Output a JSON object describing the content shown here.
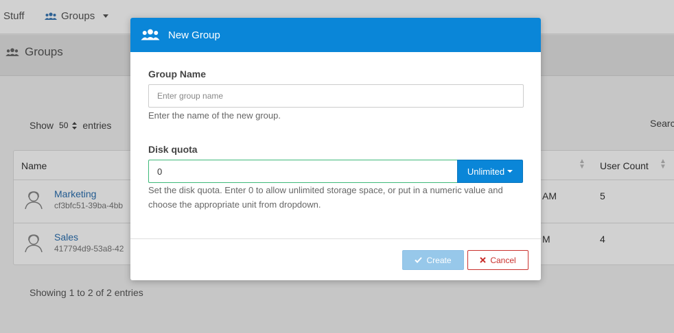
{
  "nav": {
    "stuff_label": "Stuff",
    "groups_label": "Groups"
  },
  "header": {
    "title": "Groups"
  },
  "table_controls": {
    "show_label": "Show",
    "page_size": "50",
    "entries_label": "entries",
    "search_label": "Search"
  },
  "table": {
    "columns": {
      "name": "Name",
      "user_count": "User Count"
    },
    "rows": [
      {
        "name": "Marketing",
        "id": "cf3bfc51-39ba-4bb",
        "time_suffix": "AM",
        "user_count": "5"
      },
      {
        "name": "Sales",
        "id": "417794d9-53a8-42",
        "time_suffix": "M",
        "user_count": "4"
      }
    ]
  },
  "footer": {
    "showing_text": "Showing 1 to 2 of 2 entries"
  },
  "modal": {
    "title": "New Group",
    "group_name": {
      "label": "Group Name",
      "placeholder": "Enter group name",
      "value": "",
      "help": "Enter the name of the new group."
    },
    "disk_quota": {
      "label": "Disk quota",
      "value": "0",
      "unit": "Unlimited",
      "help": "Set the disk quota. Enter 0 to allow unlimited storage space, or put in a numeric value and choose the appropriate unit from dropdown."
    },
    "create_label": "Create",
    "cancel_label": "Cancel"
  },
  "colors": {
    "primary": "#0a86d8",
    "success_border": "#3cb878",
    "danger": "#c9302c",
    "link": "#2a6fb0"
  }
}
